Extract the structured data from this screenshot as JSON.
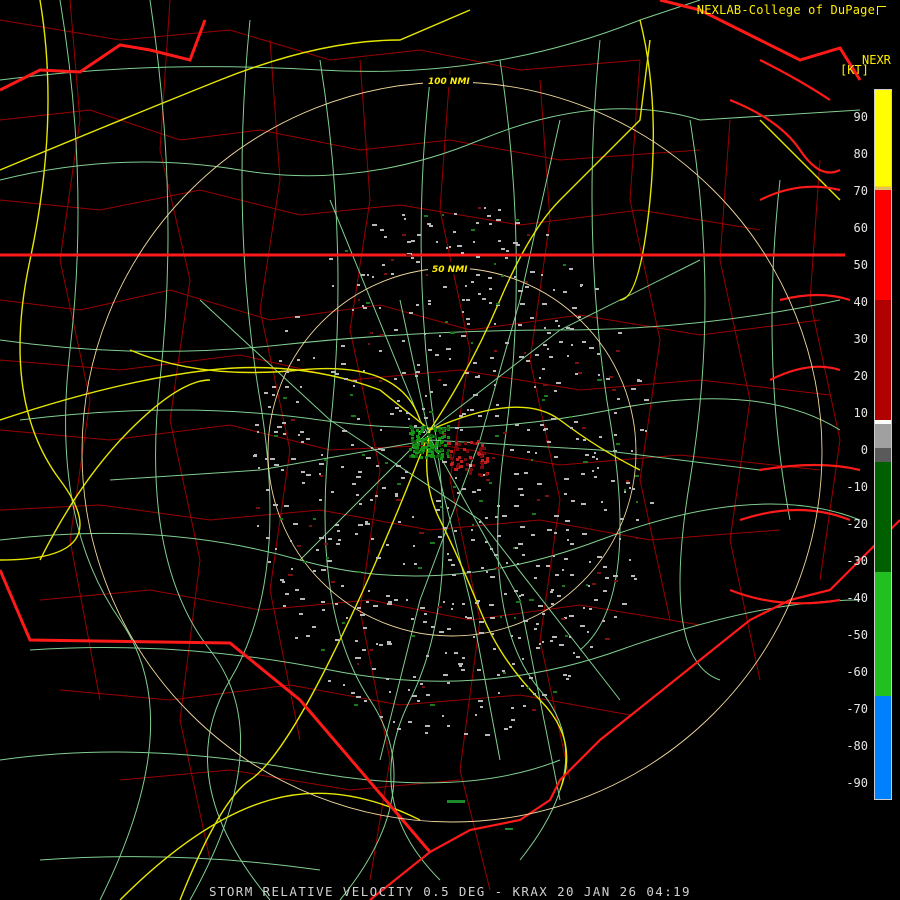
{
  "header": {
    "credit": "NEXLAB-College of DuPage",
    "credit_icon": "external-link-icon"
  },
  "scale": {
    "title": "NEXR",
    "units": "[KT]",
    "ticks": [
      "90",
      "80",
      "70",
      "60",
      "50",
      "40",
      "30",
      "20",
      "10",
      "0",
      "-10",
      "-20",
      "-30",
      "-40",
      "-50",
      "-60",
      "-70",
      "-80",
      "-90"
    ]
  },
  "rings": {
    "inner": "50 NMI",
    "outer": "100 NMI"
  },
  "footer": {
    "caption": "STORM RELATIVE VELOCITY 0.5 DEG - KRAX 20 JAN 26 04:19"
  },
  "colors": {
    "state_border": "#ff1a1a",
    "county_line": "#b30000",
    "highway": "#e6e600",
    "road": "#8fe6a0",
    "range_ring": "#f0d79a"
  }
}
